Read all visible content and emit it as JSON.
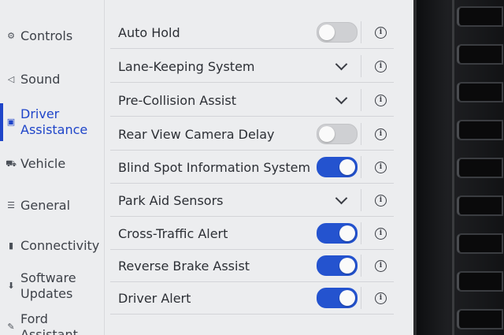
{
  "sidebar": {
    "items": [
      {
        "label": "Controls",
        "icon": "controls-icon",
        "glyph": "⚙",
        "active": false
      },
      {
        "label": "Sound",
        "icon": "speaker-icon",
        "glyph": "◁",
        "active": false
      },
      {
        "label": "Driver Assistance",
        "label_line1": "Driver",
        "label_line2": "Assistance",
        "icon": "driver-assist-icon",
        "glyph": "▣",
        "active": true
      },
      {
        "label": "Vehicle",
        "icon": "vehicle-icon",
        "glyph": "⛟",
        "active": false
      },
      {
        "label": "General",
        "icon": "sliders-icon",
        "glyph": "☰",
        "active": false
      },
      {
        "label": "Connectivity",
        "icon": "signal-icon",
        "glyph": "▮",
        "active": false
      },
      {
        "label_line1": "Software",
        "label_line2": "Updates",
        "icon": "download-icon",
        "glyph": "⬇",
        "active": false
      },
      {
        "label_line1": "Ford",
        "label_line2": "Assistant",
        "icon": "assistant-icon",
        "glyph": "✎",
        "active": false
      }
    ]
  },
  "settings": {
    "rows": [
      {
        "label": "Auto Hold",
        "control": "toggle",
        "state": "off"
      },
      {
        "label": "Lane-Keeping System",
        "control": "expand"
      },
      {
        "label": "Pre-Collision Assist",
        "control": "expand"
      },
      {
        "label": "Rear View Camera Delay",
        "control": "toggle",
        "state": "off"
      },
      {
        "label": "Blind Spot Information System",
        "control": "toggle",
        "state": "on"
      },
      {
        "label": "Park Aid Sensors",
        "control": "expand"
      },
      {
        "label": "Cross-Traffic Alert",
        "control": "toggle",
        "state": "on"
      },
      {
        "label": "Reverse Brake Assist",
        "control": "toggle",
        "state": "on"
      },
      {
        "label": "Driver Alert",
        "control": "toggle",
        "state": "on"
      }
    ],
    "info_glyph": "i"
  },
  "colors": {
    "accent": "#2453cf",
    "active_nav": "#1f45c9",
    "background": "#ecedef"
  }
}
